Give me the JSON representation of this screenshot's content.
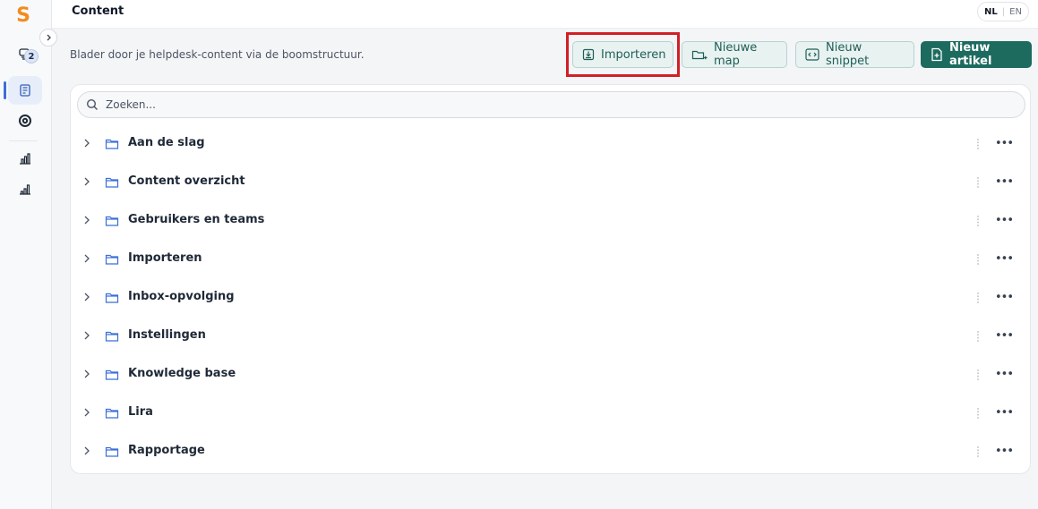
{
  "app": {
    "logo_letter": "S"
  },
  "sidebar": {
    "badge_count": "2",
    "items": [
      {
        "name": "conversations",
        "icon": "chat-stack-icon"
      },
      {
        "name": "content",
        "icon": "document-list-icon",
        "active": true
      },
      {
        "name": "help",
        "icon": "lifebuoy-icon"
      },
      {
        "name": "analytics",
        "icon": "building-chart-icon"
      },
      {
        "name": "reports",
        "icon": "bar-chart-icon"
      }
    ]
  },
  "header": {
    "title": "Content",
    "languages": [
      "NL",
      "EN"
    ],
    "active_language": "NL"
  },
  "toolbar": {
    "subtitle": "Blader door je helpdesk-content via de boomstructuur.",
    "import_label": "Importeren",
    "new_folder_label": "Nieuwe map",
    "new_snippet_label": "Nieuw snippet",
    "new_article_label": "Nieuw artikel"
  },
  "search": {
    "placeholder": "Zoeken..."
  },
  "tree": {
    "items": [
      {
        "label": "Aan de slag"
      },
      {
        "label": "Content overzicht"
      },
      {
        "label": "Gebruikers en teams"
      },
      {
        "label": "Importeren"
      },
      {
        "label": "Inbox-opvolging"
      },
      {
        "label": "Instellingen"
      },
      {
        "label": "Knowledge base"
      },
      {
        "label": "Lira"
      },
      {
        "label": "Rapportage"
      }
    ]
  },
  "colors": {
    "accent": "#1d6b5f",
    "logo": "#f28c1d",
    "highlight": "#d21f26",
    "folder": "#3b6fd8"
  }
}
